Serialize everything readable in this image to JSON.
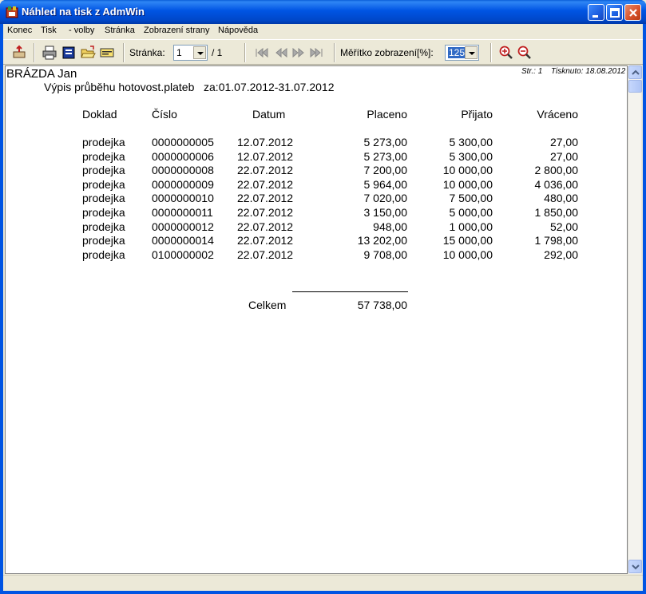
{
  "window": {
    "title": "Náhled na tisk z AdmWin"
  },
  "menu": [
    "Konec",
    "Tisk",
    "- volby",
    "Stránka",
    "Zobrazení strany",
    "Nápověda"
  ],
  "toolbar": {
    "page_label": "Stránka:",
    "page_value": "1",
    "page_total": "/ 1",
    "zoom_label": "Měřítko zobrazení[%]:",
    "zoom_value": "125"
  },
  "report": {
    "owner": "BRÁZDA Jan",
    "title": "Výpis průběhu hotovost.plateb   za:01.07.2012-31.07.2012",
    "page_info": "Str.: 1",
    "printed": "Tisknuto: 18.08.2012",
    "columns": [
      "Doklad",
      "Číslo",
      "Datum",
      "Placeno",
      "Přijato",
      "Vráceno"
    ],
    "rows": [
      [
        "prodejka",
        "0000000005",
        "12.07.2012",
        "5 273,00",
        "5 300,00",
        "27,00"
      ],
      [
        "prodejka",
        "0000000006",
        "12.07.2012",
        "5 273,00",
        "5 300,00",
        "27,00"
      ],
      [
        "prodejka",
        "0000000008",
        "22.07.2012",
        "7 200,00",
        "10 000,00",
        "2 800,00"
      ],
      [
        "prodejka",
        "0000000009",
        "22.07.2012",
        "5 964,00",
        "10 000,00",
        "4 036,00"
      ],
      [
        "prodejka",
        "0000000010",
        "22.07.2012",
        "7 020,00",
        "7 500,00",
        "480,00"
      ],
      [
        "prodejka",
        "0000000011",
        "22.07.2012",
        "3 150,00",
        "5 000,00",
        "1 850,00"
      ],
      [
        "prodejka",
        "0000000012",
        "22.07.2012",
        "948,00",
        "1 000,00",
        "52,00"
      ],
      [
        "prodejka",
        "0000000014",
        "22.07.2012",
        "13 202,00",
        "15 000,00",
        "1 798,00"
      ],
      [
        "prodejka",
        "0100000002",
        "22.07.2012",
        "9 708,00",
        "10 000,00",
        "292,00"
      ]
    ],
    "total_label": "Celkem",
    "total_value": "57 738,00"
  }
}
